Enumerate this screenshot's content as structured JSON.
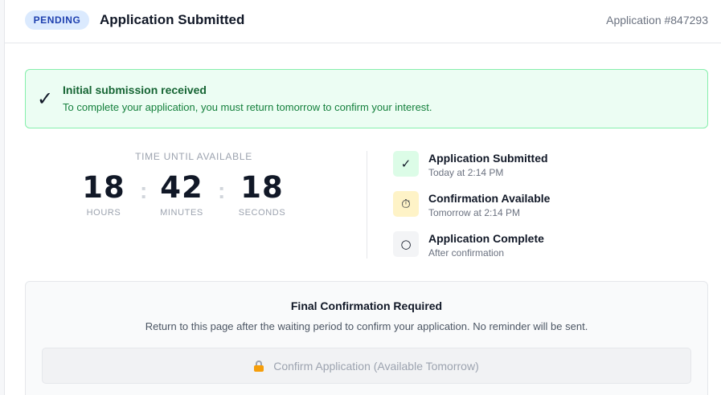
{
  "header": {
    "badge": "PENDING",
    "title": "Application Submitted",
    "application_number": "Application #847293"
  },
  "alert": {
    "icon": "check-icon",
    "title": "Initial submission received",
    "message": "To complete your application, you must return tomorrow to confirm your interest."
  },
  "countdown": {
    "label": "TIME UNTIL AVAILABLE",
    "hours": "18",
    "hours_label": "HOURS",
    "minutes": "42",
    "minutes_label": "MINUTES",
    "seconds": "18",
    "seconds_label": "SECONDS",
    "separator": ":"
  },
  "timeline": [
    {
      "icon": "check-icon",
      "glyph": "✓",
      "title": "Application Submitted",
      "subtitle": "Today at 2:14 PM",
      "color": "#dcfce7"
    },
    {
      "icon": "stopwatch-icon",
      "glyph": "⏱",
      "title": "Confirmation Available",
      "subtitle": "Tomorrow at 2:14 PM",
      "color": "#fef3c7"
    },
    {
      "icon": "circle-icon",
      "glyph": "○",
      "title": "Application Complete",
      "subtitle": "After confirmation",
      "color": "#f3f4f6"
    }
  ],
  "confirmation": {
    "title": "Final Confirmation Required",
    "text": "Return to this page after the waiting period to confirm your application. No reminder will be sent.",
    "button_label": "Confirm Application (Available Tomorrow)",
    "button_icon": "lock-icon"
  },
  "colors": {
    "badge_bg": "#dbeafe",
    "success_bg": "#ecfdf3",
    "success_border": "#86efac",
    "success_text": "#166534"
  }
}
